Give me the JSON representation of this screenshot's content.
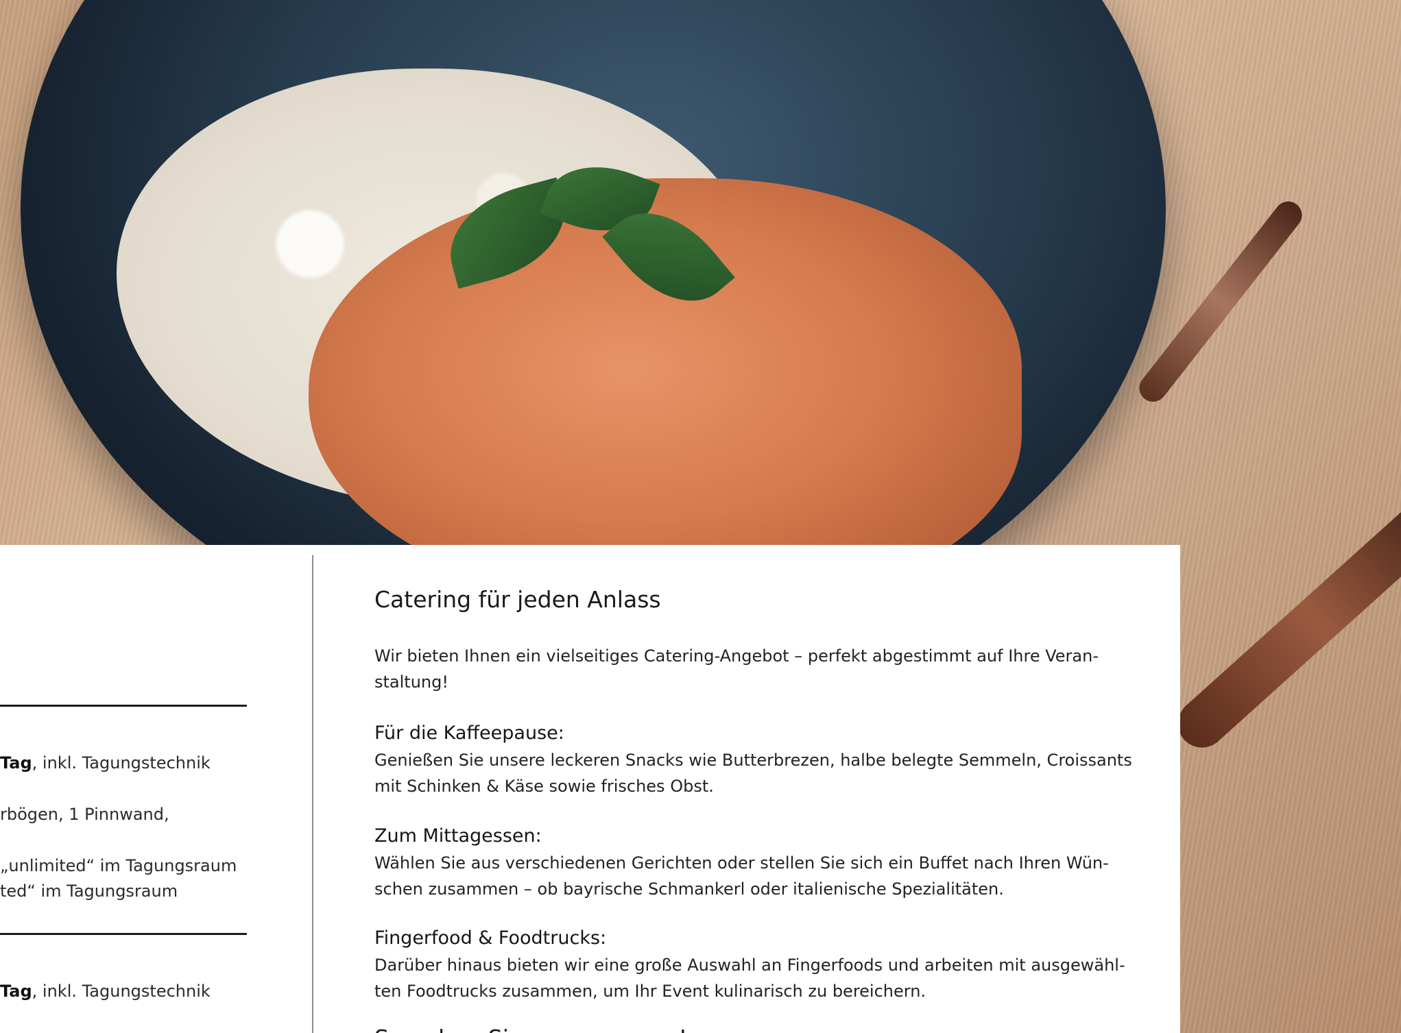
{
  "left": {
    "line1_bold": "Tag",
    "line1_rest": ", inkl. Tagungstechnik",
    "line2": "rbögen, 1 Pinnwand,",
    "line3": "„unlimited“ im Tagungsraum",
    "line4": "ted“ im Tagungsraum",
    "line5_bold": "Tag",
    "line5_rest": ", inkl. Tagungstechnik"
  },
  "main": {
    "title": "Catering für jeden Anlass",
    "intro_l1": "Wir bieten Ihnen ein vielseitiges Catering-Angebot – perfekt abgestimmt auf Ihre Veran-",
    "intro_l2": "staltung!",
    "sections": [
      {
        "heading": "Für die Kaffeepause:",
        "l1": "Genießen Sie unsere leckeren Snacks wie Butterbrezen, halbe belegte Semmeln, Croissants",
        "l2": "mit Schinken & Käse sowie frisches Obst."
      },
      {
        "heading": "Zum Mittagessen:",
        "l1": "Wählen Sie aus verschiedenen Gerichten oder stellen Sie sich ein Buffet nach Ihren Wün-",
        "l2": "schen zusammen – ob bayrische Schmankerl oder italienische Spezialitäten."
      },
      {
        "heading": "Fingerfood & Foodtrucks:",
        "l1": "Darüber hinaus bieten wir eine große Auswahl an Fingerfoods und arbeiten mit ausgewähl-",
        "l2": "ten Foodtrucks zusammen, um Ihr Event kulinarisch zu bereichern."
      }
    ],
    "cut_heading": "Sprechen Sie uns gerne an!"
  },
  "colors": {
    "panel": "#ffffff",
    "text": "#1b1b1b"
  }
}
